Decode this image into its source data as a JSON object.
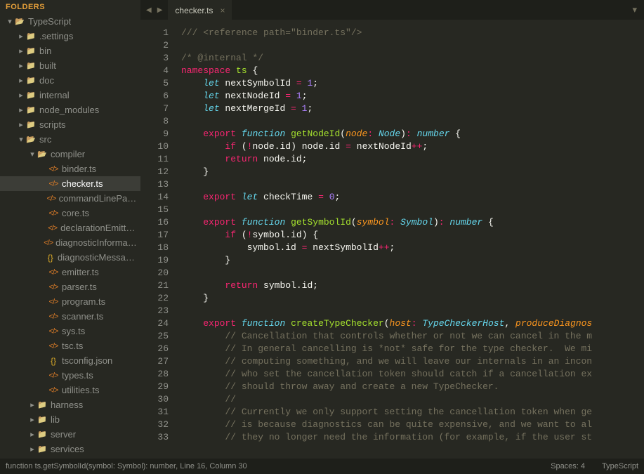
{
  "sidebar": {
    "header": "FOLDERS",
    "tree": [
      {
        "depth": 0,
        "twist": "▾",
        "icon": "folder-open",
        "label": "TypeScript",
        "inter": true
      },
      {
        "depth": 1,
        "twist": "▸",
        "icon": "folder",
        "label": ".settings",
        "inter": true
      },
      {
        "depth": 1,
        "twist": "▸",
        "icon": "folder",
        "label": "bin",
        "inter": true
      },
      {
        "depth": 1,
        "twist": "▸",
        "icon": "folder",
        "label": "built",
        "inter": true
      },
      {
        "depth": 1,
        "twist": "▸",
        "icon": "folder",
        "label": "doc",
        "inter": true
      },
      {
        "depth": 1,
        "twist": "▸",
        "icon": "folder",
        "label": "internal",
        "inter": true
      },
      {
        "depth": 1,
        "twist": "▸",
        "icon": "folder",
        "label": "node_modules",
        "inter": true
      },
      {
        "depth": 1,
        "twist": "▸",
        "icon": "folder",
        "label": "scripts",
        "inter": true
      },
      {
        "depth": 1,
        "twist": "▾",
        "icon": "folder-open",
        "label": "src",
        "inter": true
      },
      {
        "depth": 2,
        "twist": "▾",
        "icon": "folder-open",
        "label": "compiler",
        "inter": true
      },
      {
        "depth": 3,
        "twist": "",
        "icon": "ts",
        "label": "binder.ts",
        "inter": true
      },
      {
        "depth": 3,
        "twist": "",
        "icon": "ts",
        "label": "checker.ts",
        "inter": true,
        "selected": true
      },
      {
        "depth": 3,
        "twist": "",
        "icon": "ts",
        "label": "commandLineParser.ts",
        "inter": true
      },
      {
        "depth": 3,
        "twist": "",
        "icon": "ts",
        "label": "core.ts",
        "inter": true
      },
      {
        "depth": 3,
        "twist": "",
        "icon": "ts",
        "label": "declarationEmitter.ts",
        "inter": true
      },
      {
        "depth": 3,
        "twist": "",
        "icon": "ts",
        "label": "diagnosticInformationMap.generated.ts",
        "inter": true
      },
      {
        "depth": 3,
        "twist": "",
        "icon": "json",
        "label": "diagnosticMessages.json",
        "inter": true
      },
      {
        "depth": 3,
        "twist": "",
        "icon": "ts",
        "label": "emitter.ts",
        "inter": true
      },
      {
        "depth": 3,
        "twist": "",
        "icon": "ts",
        "label": "parser.ts",
        "inter": true
      },
      {
        "depth": 3,
        "twist": "",
        "icon": "ts",
        "label": "program.ts",
        "inter": true
      },
      {
        "depth": 3,
        "twist": "",
        "icon": "ts",
        "label": "scanner.ts",
        "inter": true
      },
      {
        "depth": 3,
        "twist": "",
        "icon": "ts",
        "label": "sys.ts",
        "inter": true
      },
      {
        "depth": 3,
        "twist": "",
        "icon": "ts",
        "label": "tsc.ts",
        "inter": true
      },
      {
        "depth": 3,
        "twist": "",
        "icon": "json",
        "label": "tsconfig.json",
        "inter": true
      },
      {
        "depth": 3,
        "twist": "",
        "icon": "ts",
        "label": "types.ts",
        "inter": true
      },
      {
        "depth": 3,
        "twist": "",
        "icon": "ts",
        "label": "utilities.ts",
        "inter": true
      },
      {
        "depth": 2,
        "twist": "▸",
        "icon": "folder",
        "label": "harness",
        "inter": true
      },
      {
        "depth": 2,
        "twist": "▸",
        "icon": "folder",
        "label": "lib",
        "inter": true
      },
      {
        "depth": 2,
        "twist": "▸",
        "icon": "folder",
        "label": "server",
        "inter": true
      },
      {
        "depth": 2,
        "twist": "▸",
        "icon": "folder",
        "label": "services",
        "inter": true
      }
    ]
  },
  "tabs": {
    "active": {
      "label": "checker.ts",
      "close": "×"
    },
    "menu": "▾"
  },
  "code": {
    "first_line": 1,
    "lines": [
      [
        [
          "c-com",
          "/// <reference path=\"binder.ts\"/>"
        ]
      ],
      [],
      [
        [
          "c-com",
          "/* @internal */"
        ]
      ],
      [
        [
          "c-key",
          "namespace"
        ],
        [
          "",
          " "
        ],
        [
          "c-name",
          "ts"
        ],
        [
          "",
          " "
        ],
        [
          "c-punc",
          "{"
        ]
      ],
      [
        [
          "",
          "    "
        ],
        [
          "c-stor",
          "let"
        ],
        [
          "",
          " nextSymbolId "
        ],
        [
          "c-op",
          "="
        ],
        [
          "",
          " "
        ],
        [
          "c-num",
          "1"
        ],
        [
          "c-punc",
          ";"
        ]
      ],
      [
        [
          "",
          "    "
        ],
        [
          "c-stor",
          "let"
        ],
        [
          "",
          " nextNodeId "
        ],
        [
          "c-op",
          "="
        ],
        [
          "",
          " "
        ],
        [
          "c-num",
          "1"
        ],
        [
          "c-punc",
          ";"
        ]
      ],
      [
        [
          "",
          "    "
        ],
        [
          "c-stor",
          "let"
        ],
        [
          "",
          " nextMergeId "
        ],
        [
          "c-op",
          "="
        ],
        [
          "",
          " "
        ],
        [
          "c-num",
          "1"
        ],
        [
          "c-punc",
          ";"
        ]
      ],
      [],
      [
        [
          "",
          "    "
        ],
        [
          "c-key",
          "export"
        ],
        [
          "",
          " "
        ],
        [
          "c-stor",
          "function"
        ],
        [
          "",
          " "
        ],
        [
          "c-name",
          "getNodeId"
        ],
        [
          "c-punc",
          "("
        ],
        [
          "c-param",
          "node"
        ],
        [
          "c-op",
          ":"
        ],
        [
          "",
          " "
        ],
        [
          "c-type",
          "Node"
        ],
        [
          "c-punc",
          ")"
        ],
        [
          "c-op",
          ":"
        ],
        [
          "",
          " "
        ],
        [
          "c-type",
          "number"
        ],
        [
          "",
          " "
        ],
        [
          "c-punc",
          "{"
        ]
      ],
      [
        [
          "",
          "        "
        ],
        [
          "c-key",
          "if"
        ],
        [
          "",
          " "
        ],
        [
          "c-punc",
          "("
        ],
        [
          "c-op",
          "!"
        ],
        [
          "",
          "node"
        ],
        [
          "c-punc",
          "."
        ],
        [
          "",
          "id"
        ],
        [
          "c-punc",
          ")"
        ],
        [
          "",
          " node"
        ],
        [
          "c-punc",
          "."
        ],
        [
          "",
          "id "
        ],
        [
          "c-op",
          "="
        ],
        [
          "",
          " nextNodeId"
        ],
        [
          "c-op",
          "++"
        ],
        [
          "c-punc",
          ";"
        ]
      ],
      [
        [
          "",
          "        "
        ],
        [
          "c-key",
          "return"
        ],
        [
          "",
          " node"
        ],
        [
          "c-punc",
          "."
        ],
        [
          "",
          "id"
        ],
        [
          "c-punc",
          ";"
        ]
      ],
      [
        [
          "",
          "    "
        ],
        [
          "c-punc",
          "}"
        ]
      ],
      [],
      [
        [
          "",
          "    "
        ],
        [
          "c-key",
          "export"
        ],
        [
          "",
          " "
        ],
        [
          "c-stor",
          "let"
        ],
        [
          "",
          " checkTime "
        ],
        [
          "c-op",
          "="
        ],
        [
          "",
          " "
        ],
        [
          "c-num",
          "0"
        ],
        [
          "c-punc",
          ";"
        ]
      ],
      [],
      [
        [
          "",
          "    "
        ],
        [
          "c-key",
          "export"
        ],
        [
          "",
          " "
        ],
        [
          "c-stor",
          "function"
        ],
        [
          "",
          " "
        ],
        [
          "c-name",
          "getSymbolId"
        ],
        [
          "c-punc",
          "("
        ],
        [
          "c-param",
          "symbol"
        ],
        [
          "c-op",
          ":"
        ],
        [
          "",
          " "
        ],
        [
          "c-type",
          "Symbol"
        ],
        [
          "c-punc",
          ")"
        ],
        [
          "c-op",
          ":"
        ],
        [
          "",
          " "
        ],
        [
          "c-type",
          "number"
        ],
        [
          "",
          " "
        ],
        [
          "c-punc",
          "{"
        ]
      ],
      [
        [
          "",
          "        "
        ],
        [
          "c-key",
          "if"
        ],
        [
          "",
          " "
        ],
        [
          "c-punc",
          "("
        ],
        [
          "c-op",
          "!"
        ],
        [
          "",
          "symbol"
        ],
        [
          "c-punc",
          "."
        ],
        [
          "",
          "id"
        ],
        [
          "c-punc",
          ")"
        ],
        [
          "",
          " "
        ],
        [
          "c-punc",
          "{"
        ]
      ],
      [
        [
          "",
          "            symbol"
        ],
        [
          "c-punc",
          "."
        ],
        [
          "",
          "id "
        ],
        [
          "c-op",
          "="
        ],
        [
          "",
          " nextSymbolId"
        ],
        [
          "c-op",
          "++"
        ],
        [
          "c-punc",
          ";"
        ]
      ],
      [
        [
          "",
          "        "
        ],
        [
          "c-punc",
          "}"
        ]
      ],
      [],
      [
        [
          "",
          "        "
        ],
        [
          "c-key",
          "return"
        ],
        [
          "",
          " symbol"
        ],
        [
          "c-punc",
          "."
        ],
        [
          "",
          "id"
        ],
        [
          "c-punc",
          ";"
        ]
      ],
      [
        [
          "",
          "    "
        ],
        [
          "c-punc",
          "}"
        ]
      ],
      [],
      [
        [
          "",
          "    "
        ],
        [
          "c-key",
          "export"
        ],
        [
          "",
          " "
        ],
        [
          "c-stor",
          "function"
        ],
        [
          "",
          " "
        ],
        [
          "c-name",
          "createTypeChecker"
        ],
        [
          "c-punc",
          "("
        ],
        [
          "c-param",
          "host"
        ],
        [
          "c-op",
          ":"
        ],
        [
          "",
          " "
        ],
        [
          "c-type",
          "TypeCheckerHost"
        ],
        [
          "c-punc",
          ","
        ],
        [
          "",
          " "
        ],
        [
          "c-param",
          "produceDiagnos"
        ]
      ],
      [
        [
          "",
          "        "
        ],
        [
          "c-com",
          "// Cancellation that controls whether or not we can cancel in the m"
        ]
      ],
      [
        [
          "",
          "        "
        ],
        [
          "c-com",
          "// In general cancelling is *not* safe for the type checker.  We mi"
        ]
      ],
      [
        [
          "",
          "        "
        ],
        [
          "c-com",
          "// computing something, and we will leave our internals in an incon"
        ]
      ],
      [
        [
          "",
          "        "
        ],
        [
          "c-com",
          "// who set the cancellation token should catch if a cancellation ex"
        ]
      ],
      [
        [
          "",
          "        "
        ],
        [
          "c-com",
          "// should throw away and create a new TypeChecker."
        ]
      ],
      [
        [
          "",
          "        "
        ],
        [
          "c-com",
          "//"
        ]
      ],
      [
        [
          "",
          "        "
        ],
        [
          "c-com",
          "// Currently we only support setting the cancellation token when ge"
        ]
      ],
      [
        [
          "",
          "        "
        ],
        [
          "c-com",
          "// is because diagnostics can be quite expensive, and we want to al"
        ]
      ],
      [
        [
          "",
          "        "
        ],
        [
          "c-com",
          "// they no longer need the information (for example, if the user st"
        ]
      ]
    ]
  },
  "status": {
    "left": "function ts.getSymbolId(symbol: Symbol): number, Line 16, Column 30",
    "spaces": "Spaces: 4",
    "lang": "TypeScript"
  }
}
